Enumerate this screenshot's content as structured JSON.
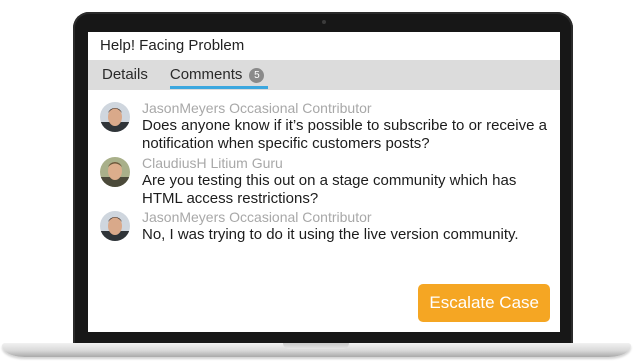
{
  "title": "Help! Facing Problem",
  "tabs": [
    {
      "label": "Details"
    },
    {
      "label": "Comments",
      "badge": "5"
    }
  ],
  "comments": [
    {
      "author": "JasonMeyers Occasional Contributor",
      "avatar_icon": "user-avatar-icon",
      "text": "Does anyone know if it’s possible to subscribe to or receive a notification when specific customers posts?"
    },
    {
      "author": "ClaudiusH Litium Guru",
      "avatar_icon": "user-avatar-icon",
      "text": "Are you testing this out on a stage community which has HTML access restrictions?"
    },
    {
      "author": "JasonMeyers Occasional Contributor",
      "avatar_icon": "user-avatar-icon",
      "text": "No, I was trying to do it using the live version community."
    }
  ],
  "actions": {
    "escalate_label": "Escalate Case"
  },
  "colors": {
    "accent": "#3ba7df",
    "escalate": "#f5a623",
    "author": "#a8a8a8",
    "tabbar": "#dcdcdc"
  }
}
